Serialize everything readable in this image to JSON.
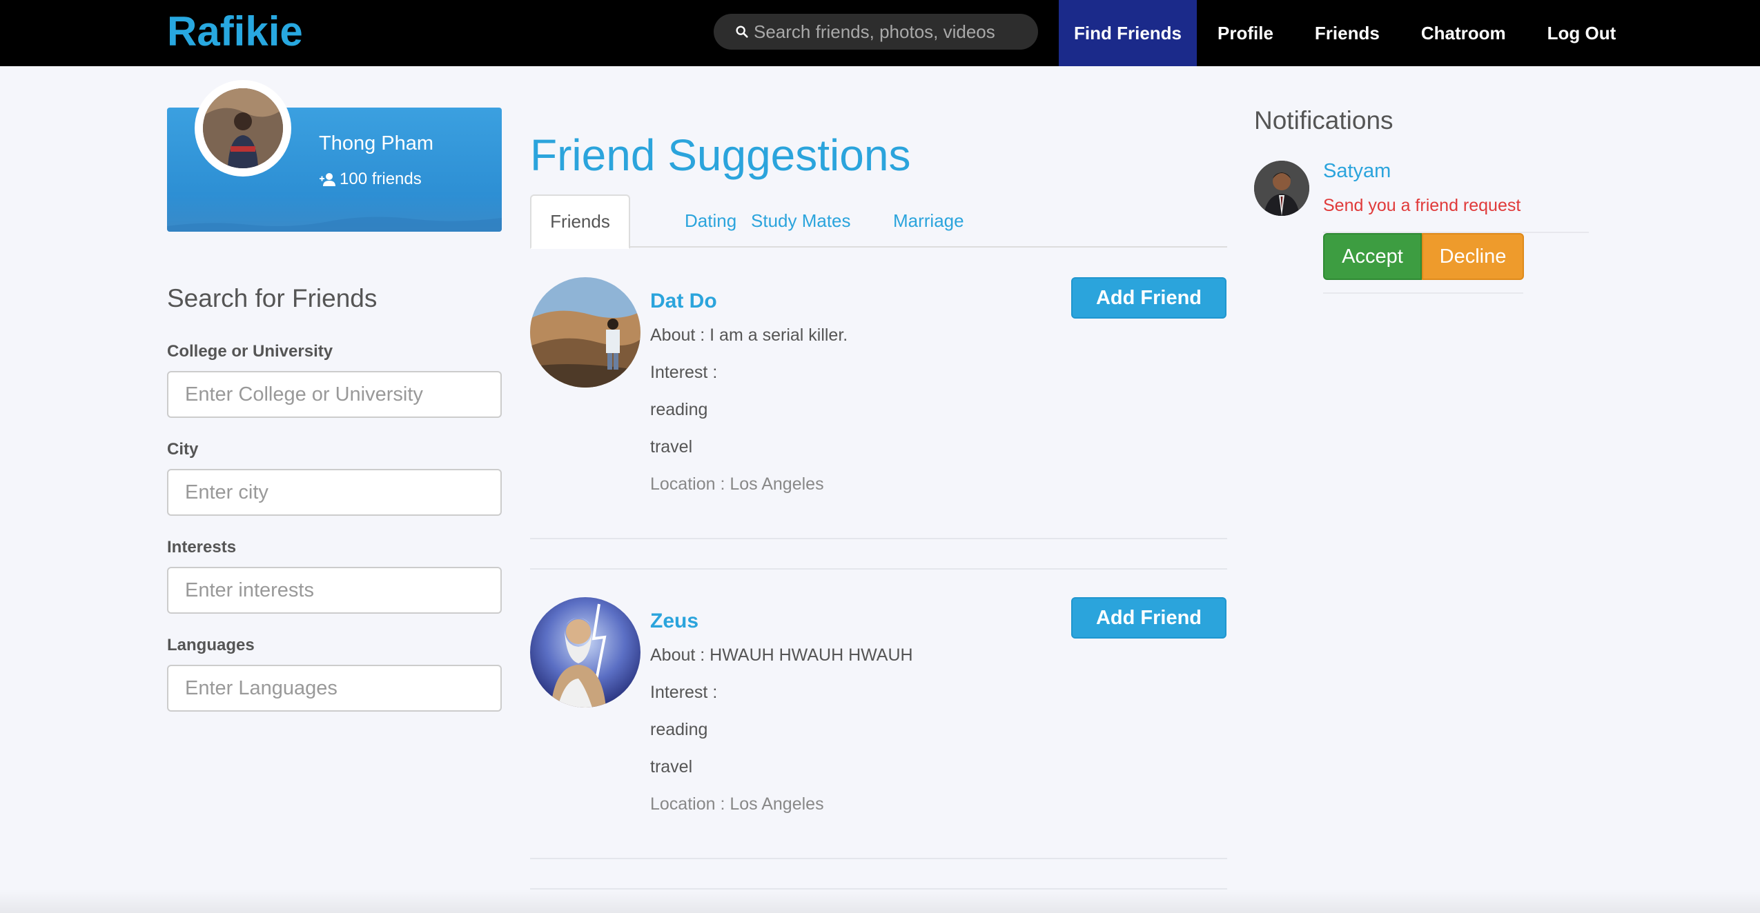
{
  "navbar": {
    "brand": "Rafikie",
    "search_placeholder": "Search friends, photos, videos",
    "links": [
      "Find Friends",
      "Profile",
      "Friends",
      "Chatroom",
      "Log Out"
    ],
    "active_link": "Find Friends"
  },
  "profile": {
    "name": "Thong Pham",
    "friends_count": "100 friends"
  },
  "search": {
    "title": "Search for Friends",
    "fields": [
      {
        "label": "College or University",
        "placeholder": "Enter College or University"
      },
      {
        "label": "City",
        "placeholder": "Enter city"
      },
      {
        "label": "Interests",
        "placeholder": "Enter interests"
      },
      {
        "label": "Languages",
        "placeholder": "Enter Languages"
      }
    ]
  },
  "suggestions": {
    "title": "Friend Suggestions",
    "tabs": [
      "Friends",
      "Dating",
      "Study Mates",
      "Marriage"
    ],
    "active_tab": "Friends",
    "add_label": "Add Friend",
    "items": [
      {
        "name": "Dat Do",
        "about": "About : I am a serial killer.",
        "interest_label": "Interest :",
        "interests": [
          "reading",
          "travel"
        ],
        "location": "Location : Los Angeles"
      },
      {
        "name": "Zeus",
        "about": "About : HWAUH HWAUH HWAUH",
        "interest_label": "Interest :",
        "interests": [
          "reading",
          "travel"
        ],
        "location": "Location : Los Angeles"
      }
    ]
  },
  "notifications": {
    "title": "Notifications",
    "items": [
      {
        "name": "Satyam",
        "message": "Send you a friend request",
        "accept_label": "Accept",
        "decline_label": "Decline"
      }
    ]
  },
  "colors": {
    "brand": "#28a8e0",
    "accent": "#2ba4dc",
    "nav_active": "#1b2a8a",
    "accept": "#3d9d41",
    "decline": "#ee9b2c",
    "alert_text": "#e03a3a"
  }
}
